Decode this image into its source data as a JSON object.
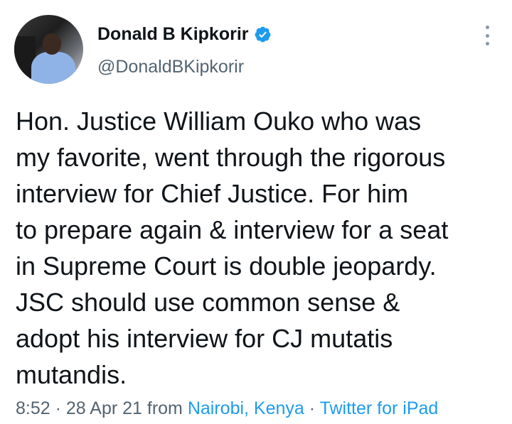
{
  "author": {
    "display_name": "Donald B Kipkorir",
    "handle": "@DonaldBKipkorir",
    "verified": true
  },
  "tweet": {
    "text": "Hon. Justice William Ouko who was\nmy favorite, went through the rigorous\ninterview for Chief Justice.  For him\nto prepare again & interview for a seat\nin Supreme Court is double jeopardy.\nJSC should use common sense &\nadopt his interview for CJ mutatis\nmutandis."
  },
  "meta": {
    "time": "8:52",
    "sep1": " · ",
    "date": "28 Apr 21",
    "from": " from ",
    "location": "Nairobi, Kenya",
    "sep2": " · ",
    "source": "Twitter for iPad"
  },
  "colors": {
    "text": "#0f1419",
    "secondary": "#536471",
    "link": "#1d9bf0",
    "verified_badge": "#1d9bf0"
  },
  "icons": {
    "verified": "verified-badge-icon",
    "more": "more-options-icon"
  }
}
